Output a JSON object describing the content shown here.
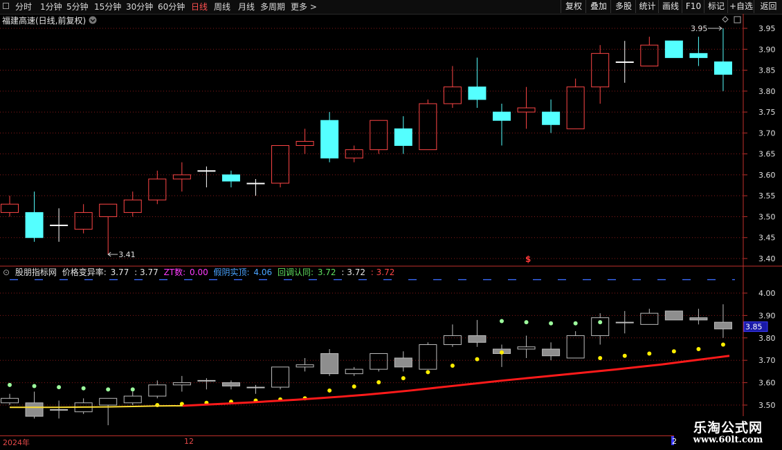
{
  "toolbar": {
    "periods": [
      "分时",
      "1分钟",
      "5分钟",
      "15分钟",
      "30分钟",
      "60分钟",
      "日线",
      "周线",
      "月线",
      "多周期",
      "更多 >"
    ],
    "active_period": "日线",
    "right_buttons": [
      "复权",
      "叠加",
      "多股",
      "统计",
      "画线",
      "F10",
      "标记",
      "+自选",
      "返回"
    ]
  },
  "main_chart": {
    "title": "福建高速(日线,前复权)",
    "high_label": "3.95",
    "low_label": "3.41",
    "marker": "$",
    "y_ticks": [
      "3.95",
      "3.90",
      "3.85",
      "3.80",
      "3.75",
      "3.70",
      "3.65",
      "3.60",
      "3.55",
      "3.50",
      "3.45",
      "3.40"
    ],
    "y_range": [
      3.37,
      3.98
    ]
  },
  "indicator": {
    "name": "股朋指标网",
    "price_label": "价格变异率:",
    "price_v1": "3.77",
    "price_v2": ": 3.77",
    "zt_label": "ZT数:",
    "zt_value": "0.00",
    "fake_label": "假阴实顶:",
    "fake_value": "4.06",
    "pullback_label": "回调认同:",
    "pullback_v1": "3.72",
    "pullback_v2": ": 3.72",
    "pullback_v3": ": 3.72",
    "y_ticks": [
      "4.00",
      "3.90",
      "3.80",
      "3.70",
      "3.60",
      "3.50"
    ],
    "y_range": [
      3.45,
      4.08
    ],
    "current_price": "3.85",
    "dash_level": 4.06
  },
  "time_axis": {
    "labels": [
      "2024年",
      "12",
      "2"
    ]
  },
  "watermark": {
    "title": "乐淘公式网",
    "url": "www.60lt.com"
  },
  "colors": {
    "up": "#ff4646",
    "down": "#54ffff",
    "doji": "#ffffff",
    "red_line": "#ff1a1a",
    "yellow_line": "#ffe033",
    "grid": "#8b1a1a"
  },
  "chart_data": {
    "type": "candlestick",
    "candles": [
      {
        "o": 3.51,
        "h": 3.55,
        "l": 3.5,
        "c": 3.53
      },
      {
        "o": 3.51,
        "h": 3.56,
        "l": 3.44,
        "c": 3.45
      },
      {
        "o": 3.48,
        "h": 3.52,
        "l": 3.44,
        "c": 3.48
      },
      {
        "o": 3.47,
        "h": 3.53,
        "l": 3.46,
        "c": 3.51
      },
      {
        "o": 3.5,
        "h": 3.53,
        "l": 3.41,
        "c": 3.53
      },
      {
        "o": 3.51,
        "h": 3.56,
        "l": 3.5,
        "c": 3.54
      },
      {
        "o": 3.54,
        "h": 3.61,
        "l": 3.53,
        "c": 3.59
      },
      {
        "o": 3.59,
        "h": 3.63,
        "l": 3.56,
        "c": 3.6
      },
      {
        "o": 3.61,
        "h": 3.62,
        "l": 3.57,
        "c": 3.61
      },
      {
        "o": 3.6,
        "h": 3.61,
        "l": 3.57,
        "c": 3.585
      },
      {
        "o": 3.58,
        "h": 3.59,
        "l": 3.55,
        "c": 3.58
      },
      {
        "o": 3.58,
        "h": 3.67,
        "l": 3.57,
        "c": 3.67
      },
      {
        "o": 3.67,
        "h": 3.71,
        "l": 3.65,
        "c": 3.68
      },
      {
        "o": 3.73,
        "h": 3.75,
        "l": 3.63,
        "c": 3.64
      },
      {
        "o": 3.64,
        "h": 3.67,
        "l": 3.63,
        "c": 3.66
      },
      {
        "o": 3.66,
        "h": 3.73,
        "l": 3.65,
        "c": 3.73
      },
      {
        "o": 3.71,
        "h": 3.74,
        "l": 3.65,
        "c": 3.67
      },
      {
        "o": 3.66,
        "h": 3.78,
        "l": 3.66,
        "c": 3.77
      },
      {
        "o": 3.77,
        "h": 3.86,
        "l": 3.76,
        "c": 3.81
      },
      {
        "o": 3.81,
        "h": 3.88,
        "l": 3.76,
        "c": 3.78
      },
      {
        "o": 3.75,
        "h": 3.77,
        "l": 3.67,
        "c": 3.73
      },
      {
        "o": 3.75,
        "h": 3.81,
        "l": 3.71,
        "c": 3.76
      },
      {
        "o": 3.75,
        "h": 3.78,
        "l": 3.7,
        "c": 3.72
      },
      {
        "o": 3.71,
        "h": 3.83,
        "l": 3.71,
        "c": 3.81
      },
      {
        "o": 3.81,
        "h": 3.91,
        "l": 3.77,
        "c": 3.89
      },
      {
        "o": 3.87,
        "h": 3.92,
        "l": 3.82,
        "c": 3.87
      },
      {
        "o": 3.86,
        "h": 3.93,
        "l": 3.86,
        "c": 3.91
      },
      {
        "o": 3.92,
        "h": 3.92,
        "l": 3.88,
        "c": 3.88
      },
      {
        "o": 3.89,
        "h": 3.93,
        "l": 3.86,
        "c": 3.88
      },
      {
        "o": 3.87,
        "h": 3.95,
        "l": 3.8,
        "c": 3.84
      }
    ],
    "green_dots": [
      3.59,
      3.585,
      3.58,
      3.575,
      3.57,
      3.57,
      null,
      null,
      null,
      null,
      null,
      null,
      null,
      null,
      null,
      null,
      null,
      null,
      null,
      null,
      3.875,
      3.87,
      3.865,
      3.865,
      3.87,
      null,
      null,
      null,
      null,
      null
    ],
    "yellow_dots": [
      null,
      null,
      null,
      null,
      null,
      null,
      3.5,
      3.505,
      3.51,
      3.515,
      3.52,
      3.525,
      3.53,
      3.565,
      3.583,
      3.602,
      3.62,
      3.647,
      3.676,
      3.705,
      3.735,
      null,
      null,
      null,
      3.71,
      3.72,
      3.73,
      3.74,
      3.75,
      3.77
    ],
    "yellow_line": [
      3.49,
      3.49,
      3.49,
      3.491,
      3.492,
      3.494,
      3.496,
      3.497
    ],
    "red_line": [
      3.497,
      3.502,
      3.507,
      3.512,
      3.518,
      3.524,
      3.531,
      3.538,
      3.546,
      3.555,
      3.565,
      3.576,
      3.587,
      3.598,
      3.609,
      3.619,
      3.629,
      3.639,
      3.649,
      3.659,
      3.67,
      3.681,
      3.694,
      3.707,
      3.72
    ]
  }
}
